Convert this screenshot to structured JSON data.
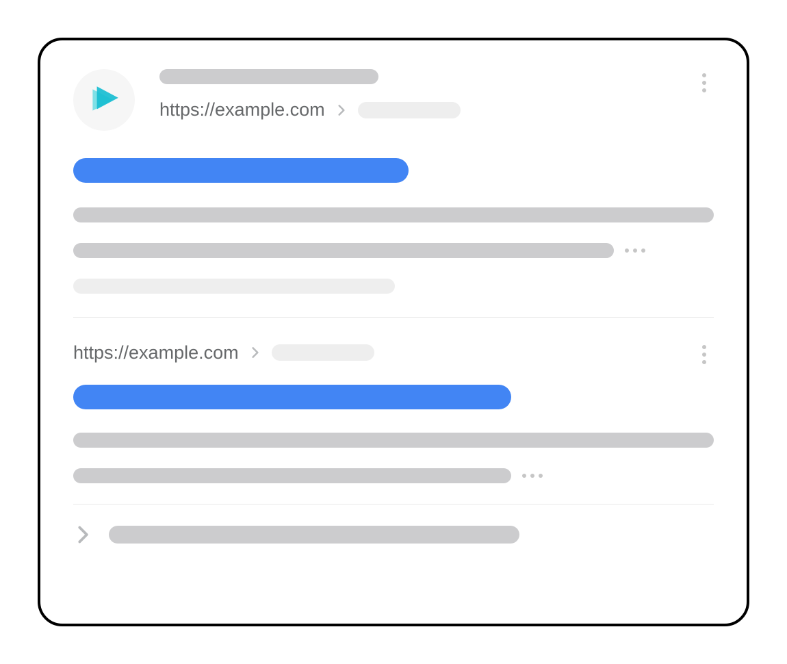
{
  "colors": {
    "title": "#4285f4",
    "placeholder": "#ccccce",
    "placeholder_light": "#eeeeee",
    "text_muted": "#66686a",
    "dot": "#c6c6c6"
  },
  "favicon": {
    "name": "site-play-icon"
  },
  "result1": {
    "url": "https://example.com"
  },
  "result2": {
    "url": "https://example.com"
  }
}
